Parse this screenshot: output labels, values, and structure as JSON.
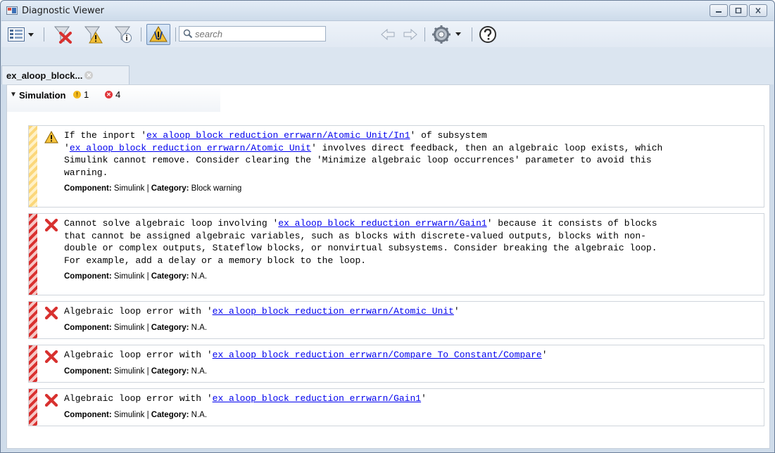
{
  "window": {
    "title": "Diagnostic Viewer",
    "buttons": [
      "minimize",
      "maximize",
      "close"
    ]
  },
  "toolbar": {
    "search_placeholder": "search",
    "icons": [
      "view-menu-icon",
      "filter-errors-icon",
      "filter-warnings-icon",
      "filter-info-icon",
      "highlight-warnings-icon",
      "prev-arrow-icon",
      "next-arrow-icon",
      "settings-icon",
      "help-icon"
    ]
  },
  "tab": {
    "label": "ex_aloop_block...",
    "close_icon": "tab-close-icon"
  },
  "group": {
    "label": "Simulation",
    "warning_count": "1",
    "error_count": "4"
  },
  "meta_labels": {
    "component": "Component:",
    "category": "Category:",
    "separator": " | "
  },
  "messages": [
    {
      "severity": "warning",
      "parts": [
        {
          "t": "If the inport '"
        },
        {
          "link": "ex_aloop_block_reduction_errwarn/Atomic Unit/In1"
        },
        {
          "t": "' of subsystem\n'"
        },
        {
          "link": "ex_aloop_block_reduction_errwarn/Atomic Unit"
        },
        {
          "t": "' involves direct feedback, then an algebraic loop exists, which\nSimulink cannot remove. Consider clearing the 'Minimize algebraic loop occurrences' parameter to avoid this\nwarning."
        }
      ],
      "component": "Simulink",
      "category": "Block warning"
    },
    {
      "severity": "error",
      "parts": [
        {
          "t": "Cannot solve algebraic loop involving '"
        },
        {
          "link": "ex_aloop_block_reduction_errwarn/Gain1"
        },
        {
          "t": "' because it consists of blocks\nthat cannot be assigned algebraic variables, such as blocks with discrete-valued outputs, blocks with non-\ndouble or complex outputs, Stateflow blocks, or nonvirtual subsystems. Consider breaking the algebraic loop.\nFor example, add a delay or a memory block to the loop."
        }
      ],
      "component": "Simulink",
      "category": "N.A."
    },
    {
      "severity": "error",
      "parts": [
        {
          "t": "Algebraic loop error with '"
        },
        {
          "link": "ex_aloop_block_reduction_errwarn/Atomic Unit"
        },
        {
          "t": "'"
        }
      ],
      "component": "Simulink",
      "category": "N.A."
    },
    {
      "severity": "error",
      "parts": [
        {
          "t": "Algebraic loop error with '"
        },
        {
          "link": "ex_aloop_block_reduction_errwarn/Compare To Constant/Compare"
        },
        {
          "t": "'"
        }
      ],
      "component": "Simulink",
      "category": "N.A."
    },
    {
      "severity": "error",
      "parts": [
        {
          "t": "Algebraic loop error with '"
        },
        {
          "link": "ex_aloop_block_reduction_errwarn/Gain1"
        },
        {
          "t": "'"
        }
      ],
      "component": "Simulink",
      "category": "N.A."
    }
  ],
  "colors": {
    "link": "#0000ee",
    "warning": "#f1b81c",
    "error": "#e0363a"
  }
}
